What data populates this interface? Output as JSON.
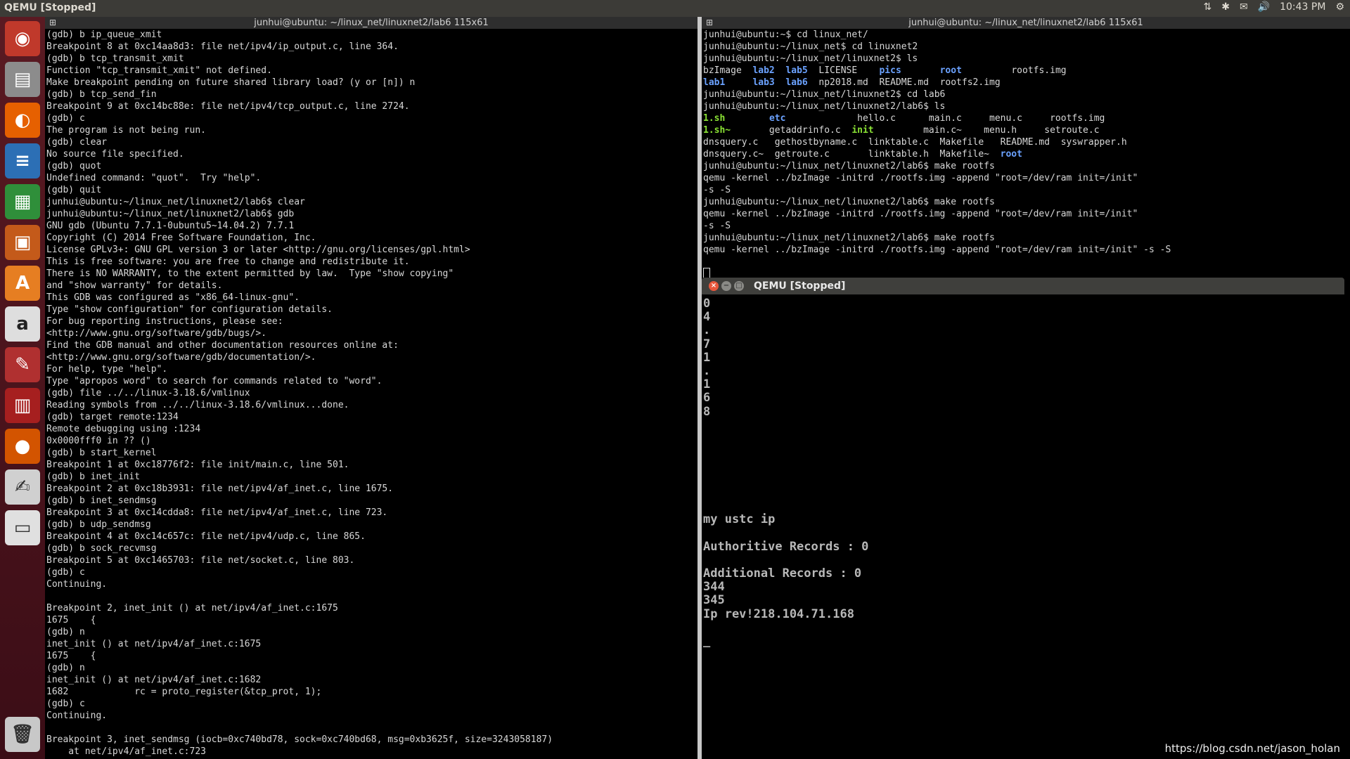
{
  "topbar": {
    "title": "QEMU [Stopped]",
    "time": "10:43 PM"
  },
  "tray_icons": [
    "network-icon",
    "bluetooth-icon",
    "mail-icon",
    "volume-icon",
    "gear-icon"
  ],
  "launcher": [
    "ubuntu-dash-icon",
    "files-icon",
    "firefox-icon",
    "writer-icon",
    "calc-icon",
    "impress-icon",
    "software-center-icon",
    "amazon-icon",
    "system-settings-icon",
    "workspace-icon",
    "ubuntu-one-icon",
    "text-editor-icon",
    "drive-icon",
    "trash-icon"
  ],
  "left_pane": {
    "title": "junhui@ubuntu: ~/linux_net/linuxnet2/lab6 115x61",
    "lines": [
      "(gdb) b ip_queue_xmit",
      "Breakpoint 8 at 0xc14aa8d3: file net/ipv4/ip_output.c, line 364.",
      "(gdb) b tcp_transmit_xmit",
      "Function \"tcp_transmit_xmit\" not defined.",
      "Make breakpoint pending on future shared library load? (y or [n]) n",
      "(gdb) b tcp_send_fin",
      "Breakpoint 9 at 0xc14bc88e: file net/ipv4/tcp_output.c, line 2724.",
      "(gdb) c",
      "The program is not being run.",
      "(gdb) clear",
      "No source file specified.",
      "(gdb) quot",
      "Undefined command: \"quot\".  Try \"help\".",
      "(gdb) quit",
      "junhui@ubuntu:~/linux_net/linuxnet2/lab6$ clear",
      "junhui@ubuntu:~/linux_net/linuxnet2/lab6$ gdb",
      "GNU gdb (Ubuntu 7.7.1-0ubuntu5~14.04.2) 7.7.1",
      "Copyright (C) 2014 Free Software Foundation, Inc.",
      "License GPLv3+: GNU GPL version 3 or later <http://gnu.org/licenses/gpl.html>",
      "This is free software: you are free to change and redistribute it.",
      "There is NO WARRANTY, to the extent permitted by law.  Type \"show copying\"",
      "and \"show warranty\" for details.",
      "This GDB was configured as \"x86_64-linux-gnu\".",
      "Type \"show configuration\" for configuration details.",
      "For bug reporting instructions, please see:",
      "<http://www.gnu.org/software/gdb/bugs/>.",
      "Find the GDB manual and other documentation resources online at:",
      "<http://www.gnu.org/software/gdb/documentation/>.",
      "For help, type \"help\".",
      "Type \"apropos word\" to search for commands related to \"word\".",
      "(gdb) file ../../linux-3.18.6/vmlinux",
      "Reading symbols from ../../linux-3.18.6/vmlinux...done.",
      "(gdb) target remote:1234",
      "Remote debugging using :1234",
      "0x0000fff0 in ?? ()",
      "(gdb) b start_kernel",
      "Breakpoint 1 at 0xc18776f2: file init/main.c, line 501.",
      "(gdb) b inet_init",
      "Breakpoint 2 at 0xc18b3931: file net/ipv4/af_inet.c, line 1675.",
      "(gdb) b inet_sendmsg",
      "Breakpoint 3 at 0xc14cdda8: file net/ipv4/af_inet.c, line 723.",
      "(gdb) b udp_sendmsg",
      "Breakpoint 4 at 0xc14c657c: file net/ipv4/udp.c, line 865.",
      "(gdb) b sock_recvmsg",
      "Breakpoint 5 at 0xc1465703: file net/socket.c, line 803.",
      "(gdb) c",
      "Continuing.",
      "",
      "Breakpoint 2, inet_init () at net/ipv4/af_inet.c:1675",
      "1675    {",
      "(gdb) n",
      "inet_init () at net/ipv4/af_inet.c:1675",
      "1675    {",
      "(gdb) n",
      "inet_init () at net/ipv4/af_inet.c:1682",
      "1682            rc = proto_register(&tcp_prot, 1);",
      "(gdb) c",
      "Continuing.",
      "",
      "Breakpoint 3, inet_sendmsg (iocb=0xc740bd78, sock=0xc740bd68, msg=0xb3625f, size=3243058187)",
      "    at net/ipv4/af_inet.c:723"
    ]
  },
  "right_pane": {
    "title": "junhui@ubuntu: ~/linux_net/linuxnet2/lab6 115x61",
    "pre": [
      "junhui@ubuntu:~$ cd linux_net/",
      "junhui@ubuntu:~/linux_net$ cd linuxnet2",
      "junhui@ubuntu:~/linux_net/linuxnet2$ ls"
    ],
    "ls1": [
      [
        {
          "t": "bzImage  ",
          "c": ""
        },
        {
          "t": "lab2",
          "c": "b"
        },
        {
          "t": "  ",
          "c": ""
        },
        {
          "t": "lab5",
          "c": "b"
        },
        {
          "t": "  LICENSE    ",
          "c": ""
        },
        {
          "t": "pics",
          "c": "b"
        },
        {
          "t": "       ",
          "c": ""
        },
        {
          "t": "root",
          "c": "b"
        },
        {
          "t": "         rootfs.img",
          "c": ""
        }
      ],
      [
        {
          "t": "lab1",
          "c": "b"
        },
        {
          "t": "     ",
          "c": ""
        },
        {
          "t": "lab3",
          "c": "b"
        },
        {
          "t": "  ",
          "c": ""
        },
        {
          "t": "lab6",
          "c": "b"
        },
        {
          "t": "  np2018.md  README.md  rootfs2.img",
          "c": ""
        }
      ]
    ],
    "mid": [
      "junhui@ubuntu:~/linux_net/linuxnet2$ cd lab6",
      "junhui@ubuntu:~/linux_net/linuxnet2/lab6$ ls"
    ],
    "ls2": [
      [
        {
          "t": "1.sh",
          "c": "g"
        },
        {
          "t": "        ",
          "c": ""
        },
        {
          "t": "etc",
          "c": "b"
        },
        {
          "t": "             hello.c      main.c     menu.c     rootfs.img",
          "c": ""
        }
      ],
      [
        {
          "t": "1.sh~",
          "c": "g"
        },
        {
          "t": "       getaddrinfo.c  ",
          "c": ""
        },
        {
          "t": "init",
          "c": "g"
        },
        {
          "t": "         main.c~    menu.h     setroute.c",
          "c": ""
        }
      ],
      [
        {
          "t": "dnsquery.c   gethostbyname.c  linktable.c  Makefile   README.md  syswrapper.h",
          "c": ""
        }
      ],
      [
        {
          "t": "dnsquery.c~  getroute.c       linktable.h  Makefile~  ",
          "c": ""
        },
        {
          "t": "root",
          "c": "b"
        }
      ]
    ],
    "post": [
      "junhui@ubuntu:~/linux_net/linuxnet2/lab6$ make rootfs",
      "qemu -kernel ../bzImage -initrd ./rootfs.img -append \"root=/dev/ram init=/init\"",
      "-s -S",
      "junhui@ubuntu:~/linux_net/linuxnet2/lab6$ make rootfs",
      "qemu -kernel ../bzImage -initrd ./rootfs.img -append \"root=/dev/ram init=/init\"",
      "-s -S",
      "junhui@ubuntu:~/linux_net/linuxnet2/lab6$ make rootfs",
      "qemu -kernel ../bzImage -initrd ./rootfs.img -append \"root=/dev/ram init=/init\" -s -S"
    ]
  },
  "qemu": {
    "title": "QEMU [Stopped]",
    "console": "0\n4\n.\n7\n1\n.\n1\n6\n8\n\n\n\n\n\n\n\nmy ustc ip\n\nAuthoritive Records : 0\n\nAdditional Records : 0\n344\n345\nIp rev!218.104.71.168\n\n_"
  },
  "watermark": "https://blog.csdn.net/jason_holan"
}
